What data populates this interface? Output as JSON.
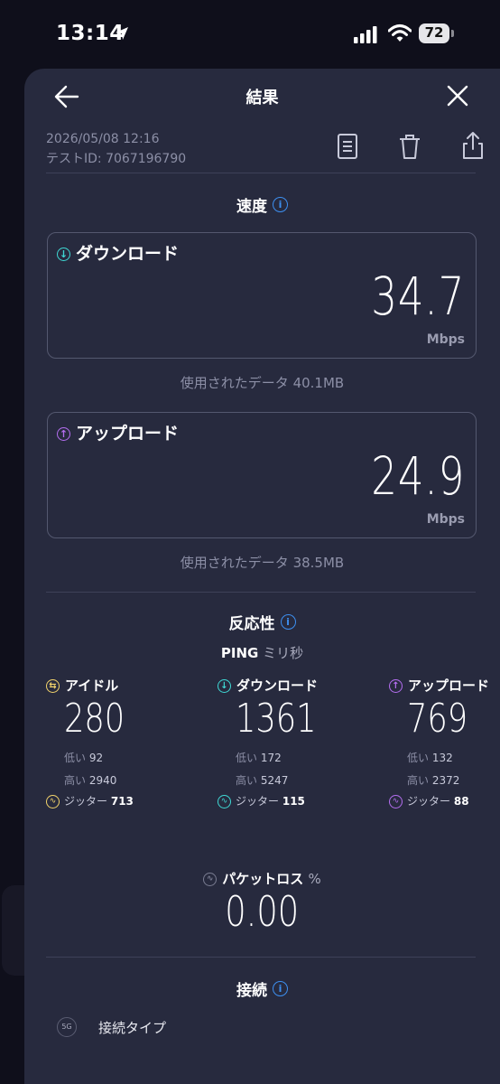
{
  "status_bar": {
    "time": "13:14",
    "battery": "72"
  },
  "header": {
    "title": "結果"
  },
  "meta": {
    "date": "2026/05/08 12:16",
    "test_id": "テストID: 7067196790"
  },
  "speed": {
    "section_title": "速度",
    "download": {
      "label": "ダウンロード",
      "value": "34.7",
      "unit": "Mbps",
      "data_used": "使用されたデータ 40.1MB"
    },
    "upload": {
      "label": "アップロード",
      "value": "24.9",
      "unit": "Mbps",
      "data_used": "使用されたデータ 38.5MB"
    }
  },
  "responsiveness": {
    "section_title": "反応性",
    "ping_label": "PING",
    "ping_unit": "ミリ秒",
    "idle": {
      "label": "アイドル",
      "value": "280",
      "low_label": "低い",
      "low": "92",
      "high_label": "高い",
      "high": "2940",
      "jitter_label": "ジッター",
      "jitter": "713"
    },
    "download": {
      "label": "ダウンロード",
      "value": "1361",
      "low_label": "低い",
      "low": "172",
      "high_label": "高い",
      "high": "5247",
      "jitter_label": "ジッター",
      "jitter": "115"
    },
    "upload": {
      "label": "アップロード",
      "value": "769",
      "low_label": "低い",
      "low": "132",
      "high_label": "高い",
      "high": "2372",
      "jitter_label": "ジッター",
      "jitter": "88"
    }
  },
  "packet_loss": {
    "label": "パケットロス",
    "unit": "%",
    "value": "0.00"
  },
  "connection": {
    "section_title": "接続",
    "type_badge": "5G",
    "type_label": "接続タイプ"
  },
  "colors": {
    "background": "#0f0f1b",
    "sheet": "#272a3e",
    "download_accent": "#3fd8d4",
    "upload_accent": "#b46ef0",
    "idle_accent": "#f2d36b",
    "info_accent": "#3d8ff0"
  },
  "icons": [
    "location-arrow-icon",
    "signal-icon",
    "wifi-icon",
    "back-arrow-icon",
    "close-icon",
    "document-icon",
    "trash-icon",
    "share-icon",
    "info-icon",
    "download-icon",
    "upload-icon",
    "idle-icon",
    "jitter-icon",
    "packet-loss-icon",
    "5g-icon"
  ]
}
